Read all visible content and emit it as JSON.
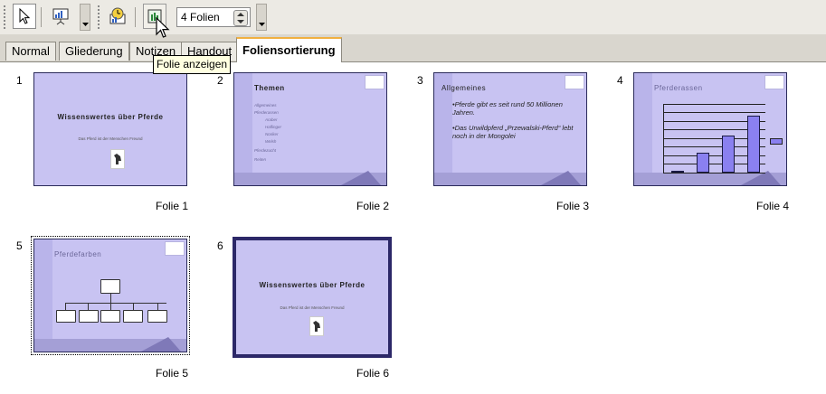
{
  "toolbar": {
    "icons": [
      "select-arrow-icon",
      "slide-show-icon",
      "slide-transition-icon",
      "show-slide-icon"
    ],
    "slides_per_row": "4 Folien"
  },
  "tabs": [
    {
      "label": "Normal"
    },
    {
      "label": "Gliederung"
    },
    {
      "label": "Notizen"
    },
    {
      "label": "Handout"
    },
    {
      "label": "Foliensortierung",
      "active": true
    }
  ],
  "tooltip": "Folie anzeigen",
  "slides": [
    {
      "number": "1",
      "caption": "Folie 1",
      "title": "Wissenswertes über Pferde",
      "subtitle": "Das Pferd ist der Menschen Freund"
    },
    {
      "number": "2",
      "caption": "Folie 2",
      "title": "Themen",
      "bullets": [
        "Allgemeines",
        "Pferderassen",
        "Araber",
        "Haflinger",
        "Noriker",
        "Welsh",
        "Pferdezucht",
        "Reiten"
      ]
    },
    {
      "number": "3",
      "caption": "Folie 3",
      "title": "Allgemeines",
      "bullets": [
        "Pferde gibt es seit rund 50 Millionen Jahren.",
        "Das Urwildpferd „Przewalski-Pferd“ lebt noch in der Mongolei"
      ]
    },
    {
      "number": "4",
      "caption": "Folie 4",
      "title": "Pferderassen",
      "chart_values": [
        2,
        20,
        38,
        58
      ]
    },
    {
      "number": "5",
      "caption": "Folie 5",
      "title": "Pferdefarben"
    },
    {
      "number": "6",
      "caption": "Folie 6",
      "title": "Wissenswertes über Pferde",
      "subtitle": "Das Pferd ist der Menschen Freund"
    }
  ]
}
